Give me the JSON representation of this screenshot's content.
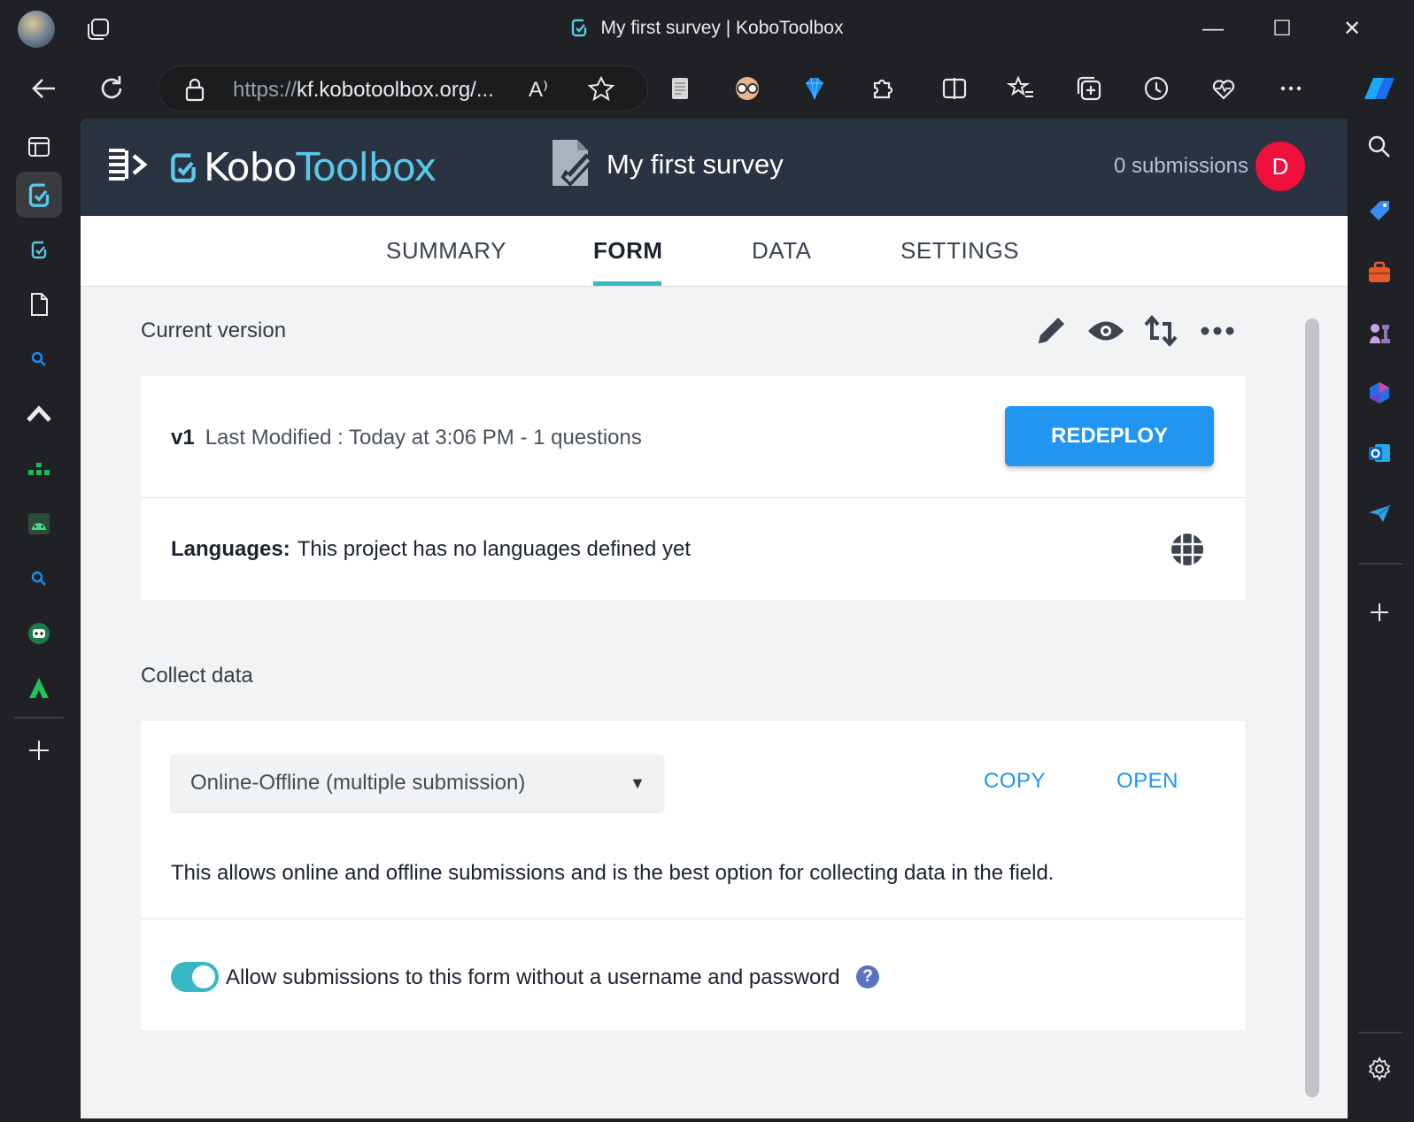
{
  "window": {
    "title": "My first survey | KoboToolbox",
    "minimize": "—",
    "maximize": "☐",
    "close": "✕"
  },
  "toolbar": {
    "url_prefix": "https://",
    "url_host": "kf.kobotoolbox.org/...",
    "read_aloud": "A⁾"
  },
  "header": {
    "logo_kobo": "Kobo",
    "logo_toolbox": "Toolbox",
    "survey_title": "My first survey",
    "submissions": "0 submissions",
    "user_initial": "D"
  },
  "tabs": [
    {
      "label": "SUMMARY"
    },
    {
      "label": "FORM"
    },
    {
      "label": "DATA"
    },
    {
      "label": "SETTINGS"
    }
  ],
  "current_version": {
    "heading": "Current version",
    "version": "v1",
    "modified": "Last Modified : Today at 3:06 PM - 1 questions",
    "redeploy_label": "REDEPLOY",
    "languages_label": "Languages:",
    "languages_text": "This project has no languages defined yet"
  },
  "collect": {
    "heading": "Collect data",
    "selected_option": "Online-Offline (multiple submission)",
    "caret": "▼",
    "copy_label": "COPY",
    "open_label": "OPEN",
    "description": "This allows online and offline submissions and is the best option for collecting data in the field.",
    "toggle_label": "Allow submissions to this form without a username and password",
    "toggle_on": true,
    "help": "?"
  },
  "colors": {
    "header_bg": "#2a3342",
    "accent_teal": "#35b7c4",
    "primary_blue": "#2095f2",
    "avatar_red": "#f0103c"
  }
}
